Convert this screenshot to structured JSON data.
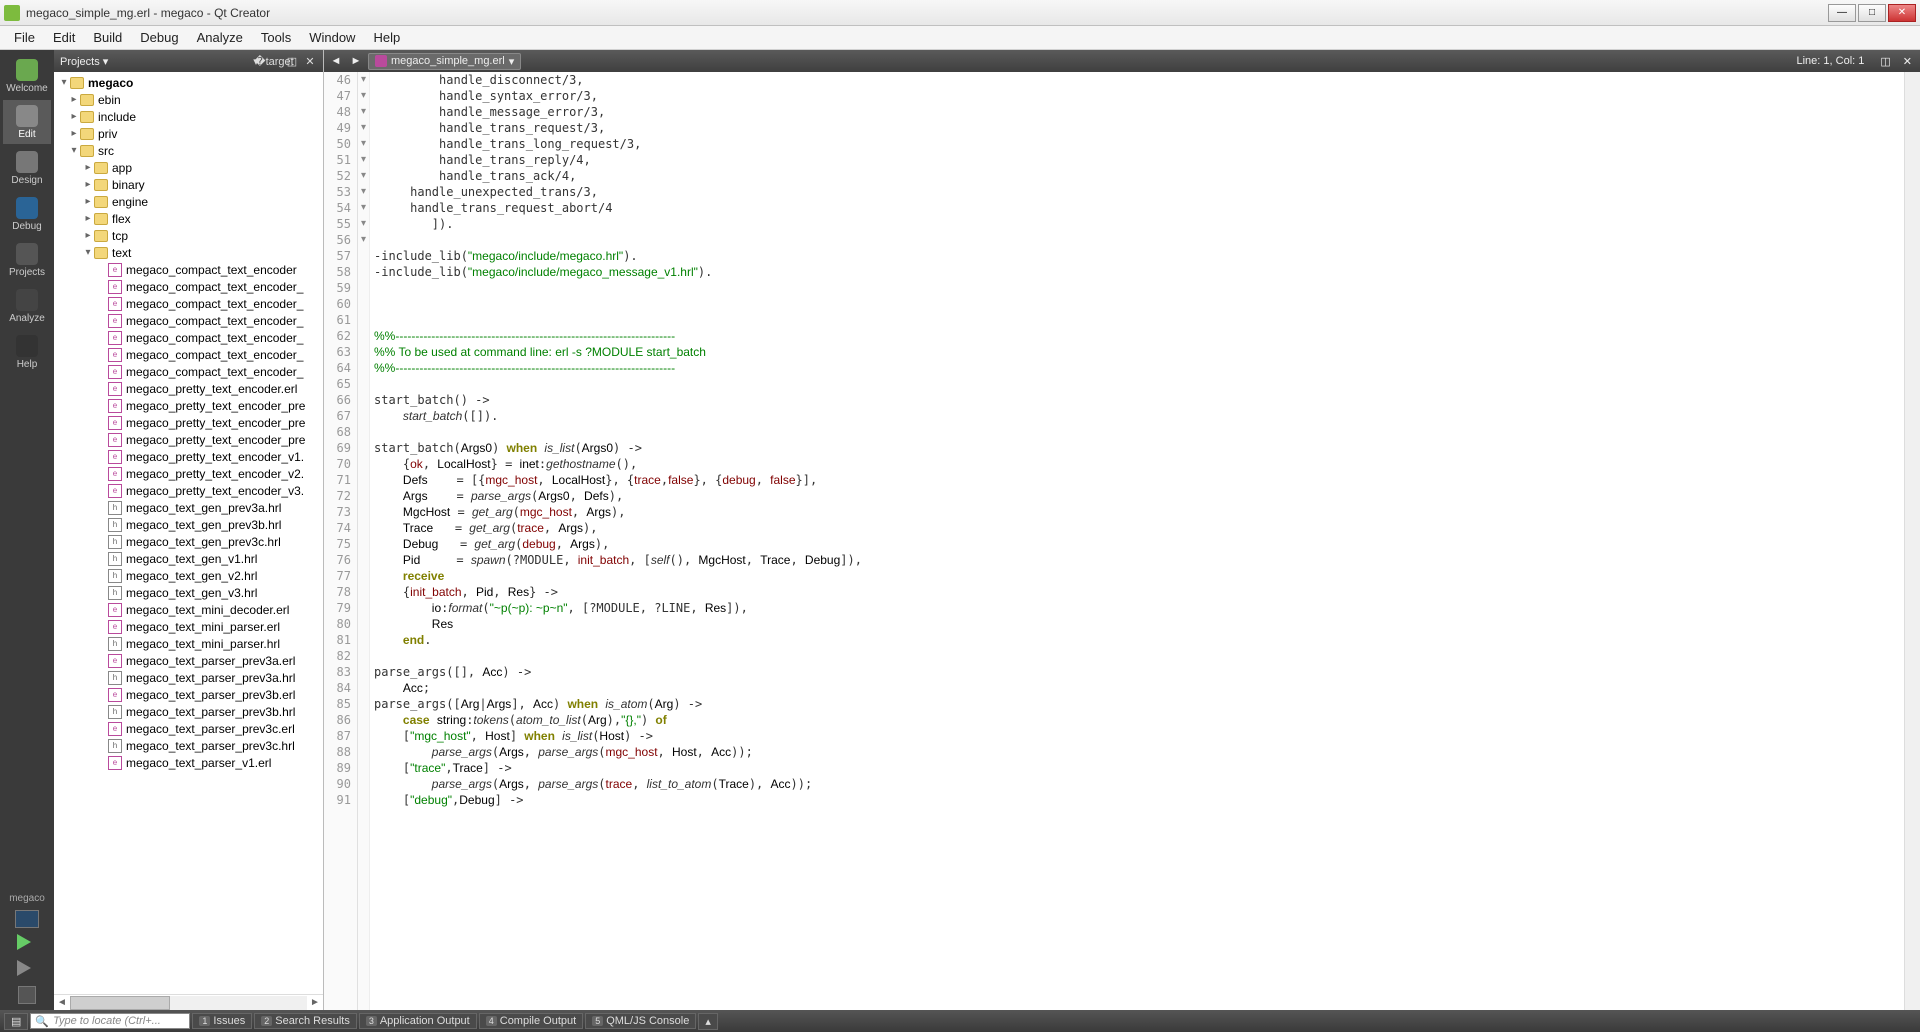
{
  "window": {
    "title": "megaco_simple_mg.erl - megaco - Qt Creator"
  },
  "menu": [
    "File",
    "Edit",
    "Build",
    "Debug",
    "Analyze",
    "Tools",
    "Window",
    "Help"
  ],
  "modes": [
    {
      "id": "welcome",
      "label": "Welcome"
    },
    {
      "id": "edit",
      "label": "Edit"
    },
    {
      "id": "design",
      "label": "Design"
    },
    {
      "id": "debug",
      "label": "Debug"
    },
    {
      "id": "projects",
      "label": "Projects"
    },
    {
      "id": "analyze",
      "label": "Analyze"
    },
    {
      "id": "help",
      "label": "Help"
    }
  ],
  "modebar_bottom": {
    "project": "megaco"
  },
  "side": {
    "header": "Projects",
    "root": "megaco",
    "folders_top": [
      "ebin",
      "include",
      "priv"
    ],
    "src": "src",
    "src_children": [
      "app",
      "binary",
      "engine",
      "flex",
      "tcp"
    ],
    "text_folder": "text",
    "files": [
      {
        "n": "megaco_compact_text_encoder",
        "t": "erl"
      },
      {
        "n": "megaco_compact_text_encoder_",
        "t": "erl"
      },
      {
        "n": "megaco_compact_text_encoder_",
        "t": "erl"
      },
      {
        "n": "megaco_compact_text_encoder_",
        "t": "erl"
      },
      {
        "n": "megaco_compact_text_encoder_",
        "t": "erl"
      },
      {
        "n": "megaco_compact_text_encoder_",
        "t": "erl"
      },
      {
        "n": "megaco_compact_text_encoder_",
        "t": "erl"
      },
      {
        "n": "megaco_pretty_text_encoder.erl",
        "t": "erl"
      },
      {
        "n": "megaco_pretty_text_encoder_pre",
        "t": "erl"
      },
      {
        "n": "megaco_pretty_text_encoder_pre",
        "t": "erl"
      },
      {
        "n": "megaco_pretty_text_encoder_pre",
        "t": "erl"
      },
      {
        "n": "megaco_pretty_text_encoder_v1.",
        "t": "erl"
      },
      {
        "n": "megaco_pretty_text_encoder_v2.",
        "t": "erl"
      },
      {
        "n": "megaco_pretty_text_encoder_v3.",
        "t": "erl"
      },
      {
        "n": "megaco_text_gen_prev3a.hrl",
        "t": "h"
      },
      {
        "n": "megaco_text_gen_prev3b.hrl",
        "t": "h"
      },
      {
        "n": "megaco_text_gen_prev3c.hrl",
        "t": "h"
      },
      {
        "n": "megaco_text_gen_v1.hrl",
        "t": "h"
      },
      {
        "n": "megaco_text_gen_v2.hrl",
        "t": "h"
      },
      {
        "n": "megaco_text_gen_v3.hrl",
        "t": "h"
      },
      {
        "n": "megaco_text_mini_decoder.erl",
        "t": "erl"
      },
      {
        "n": "megaco_text_mini_parser.erl",
        "t": "erl"
      },
      {
        "n": "megaco_text_mini_parser.hrl",
        "t": "h"
      },
      {
        "n": "megaco_text_parser_prev3a.erl",
        "t": "erl"
      },
      {
        "n": "megaco_text_parser_prev3a.hrl",
        "t": "h"
      },
      {
        "n": "megaco_text_parser_prev3b.erl",
        "t": "erl"
      },
      {
        "n": "megaco_text_parser_prev3b.hrl",
        "t": "h"
      },
      {
        "n": "megaco_text_parser_prev3c.erl",
        "t": "erl"
      },
      {
        "n": "megaco_text_parser_prev3c.hrl",
        "t": "h"
      },
      {
        "n": "megaco_text_parser_v1.erl",
        "t": "erl"
      }
    ]
  },
  "editor": {
    "filename": "megaco_simple_mg.erl",
    "status": "Line: 1, Col: 1",
    "first_line": 46,
    "fold_lines": [
      62,
      66,
      69,
      77,
      78,
      83,
      85,
      86,
      87,
      89,
      91
    ],
    "lines": [
      {
        "t": "plain",
        "s": "         handle_disconnect/3,"
      },
      {
        "t": "plain",
        "s": "         handle_syntax_error/3,"
      },
      {
        "t": "plain",
        "s": "         handle_message_error/3,"
      },
      {
        "t": "plain",
        "s": "         handle_trans_request/3,"
      },
      {
        "t": "plain",
        "s": "         handle_trans_long_request/3,"
      },
      {
        "t": "plain",
        "s": "         handle_trans_reply/4,"
      },
      {
        "t": "plain",
        "s": "         handle_trans_ack/4,"
      },
      {
        "t": "plain",
        "s": "     handle_unexpected_trans/3,"
      },
      {
        "t": "plain",
        "s": "     handle_trans_request_abort/4"
      },
      {
        "t": "plain",
        "s": "        ])."
      },
      {
        "t": "plain",
        "s": ""
      },
      {
        "t": "inc",
        "a": "-include_lib(",
        "b": "\"megaco/include/megaco.hrl\"",
        "c": ")."
      },
      {
        "t": "inc",
        "a": "-include_lib(",
        "b": "\"megaco/include/megaco_message_v1.hrl\"",
        "c": ")."
      },
      {
        "t": "plain",
        "s": ""
      },
      {
        "t": "plain",
        "s": ""
      },
      {
        "t": "plain",
        "s": ""
      },
      {
        "t": "cmt",
        "s": "%%----------------------------------------------------------------------"
      },
      {
        "t": "cmt",
        "s": "%% To be used at command line: erl -s ?MODULE start_batch"
      },
      {
        "t": "cmt",
        "s": "%%----------------------------------------------------------------------"
      },
      {
        "t": "plain",
        "s": ""
      },
      {
        "t": "raw",
        "h": "start_batch() -&gt;"
      },
      {
        "t": "raw",
        "h": "    <span class='fn'>start_batch</span>([])."
      },
      {
        "t": "plain",
        "s": ""
      },
      {
        "t": "raw",
        "h": "start_batch(<span class='var'>Args0</span>) <span class='kw'>when</span> <span class='fn'>is_list</span>(<span class='var'>Args0</span>) -&gt;"
      },
      {
        "t": "raw",
        "h": "    {<span class='atom'>ok</span>, <span class='var'>LocalHost</span>} = <span class='mod'>inet</span>:<span class='fn'>gethostname</span>(),"
      },
      {
        "t": "raw",
        "h": "    <span class='var'>Defs</span>    = [{<span class='atom'>mgc_host</span>, <span class='var'>LocalHost</span>}, {<span class='atom'>trace</span>,<span class='atom'>false</span>}, {<span class='atom'>debug</span>, <span class='atom'>false</span>}],"
      },
      {
        "t": "raw",
        "h": "    <span class='var'>Args</span>    = <span class='fn'>parse_args</span>(<span class='var'>Args0</span>, <span class='var'>Defs</span>),"
      },
      {
        "t": "raw",
        "h": "    <span class='var'>MgcHost</span> = <span class='fn'>get_arg</span>(<span class='atom'>mgc_host</span>, <span class='var'>Args</span>),"
      },
      {
        "t": "raw",
        "h": "    <span class='var'>Trace</span>   = <span class='fn'>get_arg</span>(<span class='atom'>trace</span>, <span class='var'>Args</span>),"
      },
      {
        "t": "raw",
        "h": "    <span class='var'>Debug</span>   = <span class='fn'>get_arg</span>(<span class='atom'>debug</span>, <span class='var'>Args</span>),"
      },
      {
        "t": "raw",
        "h": "    <span class='var'>Pid</span>     = <span class='fn'>spawn</span>(?MODULE, <span class='atom'>init_batch</span>, [<span class='fn'>self</span>(), <span class='var'>MgcHost</span>, <span class='var'>Trace</span>, <span class='var'>Debug</span>]),"
      },
      {
        "t": "raw",
        "h": "    <span class='kw'>receive</span>"
      },
      {
        "t": "raw",
        "h": "    {<span class='atom'>init_batch</span>, <span class='var'>Pid</span>, <span class='var'>Res</span>} -&gt;"
      },
      {
        "t": "raw",
        "h": "        <span class='mod'>io</span>:<span class='fn'>format</span>(<span class='str'>\"~p(~p): ~p~n\"</span>, [?MODULE, ?LINE, <span class='var'>Res</span>]),"
      },
      {
        "t": "raw",
        "h": "        <span class='var'>Res</span>"
      },
      {
        "t": "raw",
        "h": "    <span class='kw'>end</span>."
      },
      {
        "t": "plain",
        "s": ""
      },
      {
        "t": "raw",
        "h": "parse_args([], <span class='var'>Acc</span>) -&gt;"
      },
      {
        "t": "raw",
        "h": "    <span class='var'>Acc</span>;"
      },
      {
        "t": "raw",
        "h": "parse_args([<span class='var'>Arg</span>|<span class='var'>Args</span>], <span class='var'>Acc</span>) <span class='kw'>when</span> <span class='fn'>is_atom</span>(<span class='var'>Arg</span>) -&gt;"
      },
      {
        "t": "raw",
        "h": "    <span class='kw'>case</span> <span class='mod'>string</span>:<span class='fn'>tokens</span>(<span class='fn'>atom_to_list</span>(<span class='var'>Arg</span>),<span class='str'>\"{},\"</span>) <span class='kw'>of</span>"
      },
      {
        "t": "raw",
        "h": "    [<span class='str'>\"mgc_host\"</span>, <span class='var'>Host</span>] <span class='kw'>when</span> <span class='fn'>is_list</span>(<span class='var'>Host</span>) -&gt;"
      },
      {
        "t": "raw",
        "h": "        <span class='fn'>parse_args</span>(<span class='var'>Args</span>, <span class='fn'>parse_args</span>(<span class='atom'>mgc_host</span>, <span class='var'>Host</span>, <span class='var'>Acc</span>));"
      },
      {
        "t": "raw",
        "h": "    [<span class='str'>\"trace\"</span>,<span class='var'>Trace</span>] -&gt;"
      },
      {
        "t": "raw",
        "h": "        <span class='fn'>parse_args</span>(<span class='var'>Args</span>, <span class='fn'>parse_args</span>(<span class='atom'>trace</span>, <span class='fn'>list_to_atom</span>(<span class='var'>Trace</span>), <span class='var'>Acc</span>));"
      },
      {
        "t": "raw",
        "h": "    [<span class='str'>\"debug\"</span>,<span class='var'>Debug</span>] -&gt;"
      }
    ]
  },
  "bottom": {
    "search_placeholder": "Type to locate (Ctrl+...",
    "tabs": [
      {
        "n": "1",
        "l": "Issues"
      },
      {
        "n": "2",
        "l": "Search Results"
      },
      {
        "n": "3",
        "l": "Application Output"
      },
      {
        "n": "4",
        "l": "Compile Output"
      },
      {
        "n": "5",
        "l": "QML/JS Console"
      }
    ]
  }
}
